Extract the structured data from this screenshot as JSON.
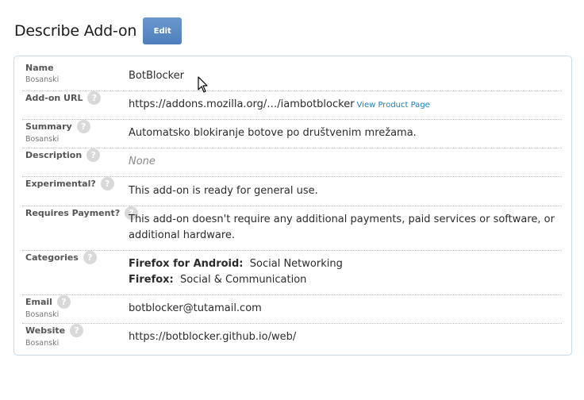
{
  "header": {
    "title": "Describe Add-on",
    "edit_label": "Edit"
  },
  "fields": {
    "name": {
      "label": "Name",
      "locale": "Bosanski",
      "value": "BotBlocker"
    },
    "url": {
      "label": "Add-on URL",
      "value": "https://addons.mozilla.org/…/iambotblocker",
      "link": "View Product Page"
    },
    "summary": {
      "label": "Summary",
      "locale": "Bosanski",
      "value": "Automatsko blokiranje botove po društvenim mrežama."
    },
    "description": {
      "label": "Description",
      "value": "None"
    },
    "experimental": {
      "label": "Experimental?",
      "value": "This add-on is ready for general use."
    },
    "payment": {
      "label": "Requires Payment?",
      "value_line1": "This add-on doesn't require any additional payments, paid services or software, or",
      "value_line2": "additional hardware."
    },
    "categories": {
      "label": "Categories",
      "items": [
        {
          "app": "Firefox for Android:",
          "category": "Social Networking"
        },
        {
          "app": "Firefox:",
          "category": "Social & Communication"
        }
      ]
    },
    "email": {
      "label": "Email",
      "locale": "Bosanski",
      "value": "botblocker@tutamail.com"
    },
    "website": {
      "label": "Website",
      "locale": "Bosanski",
      "value": "https://botblocker.github.io/web/"
    }
  },
  "help_glyph": "?"
}
